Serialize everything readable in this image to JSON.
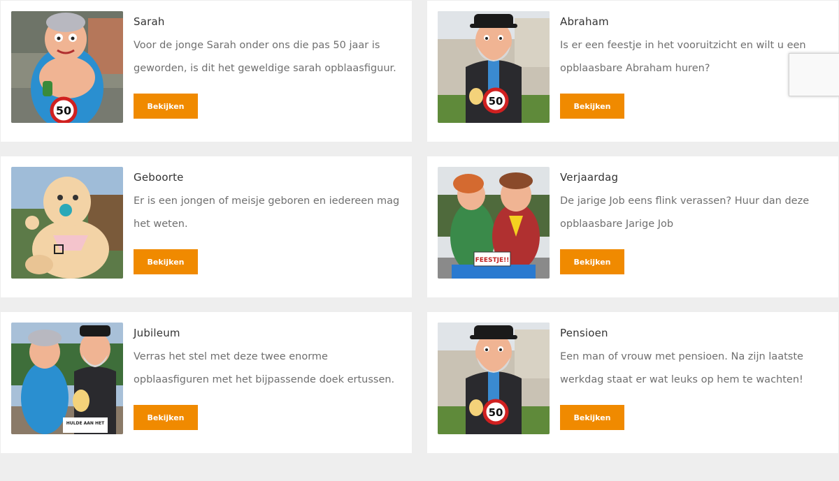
{
  "cards": [
    {
      "title": "Sarah",
      "description": "Voor de jonge Sarah onder ons die pas 50 jaar is geworden, is dit het geweldige sarah opblaasfiguur.",
      "button": "Bekijken",
      "image": "sarah-inflatable-photo"
    },
    {
      "title": "Abraham",
      "description": "Is er een feestje in het vooruitzicht en wilt u een opblaasbare Abraham huren?",
      "button": "Bekijken",
      "image": "abraham-inflatable-photo"
    },
    {
      "title": "Geboorte",
      "description": "Er is een jongen of meisje geboren en iedereen mag het weten.",
      "button": "Bekijken",
      "image": "baby-inflatable-photo"
    },
    {
      "title": "Verjaardag",
      "description": "De jarige Job eens flink verassen? Huur dan deze opblaasbare Jarige Job",
      "button": "Bekijken",
      "image": "birthday-couple-inflatable-photo",
      "sign_text": "FEESTJE!!"
    },
    {
      "title": "Jubileum",
      "description": "Verras het stel met deze twee enorme opblaasfiguren met het bijpassende doek ertussen.",
      "button": "Bekijken",
      "image": "jubilee-couple-inflatable-photo",
      "sign_text": "HULDE AAN HET"
    },
    {
      "title": "Pensioen",
      "description": "Een man of vrouw met pensioen. Na zijn laatste werkdag staat er wat leuks op hem te wachten!",
      "button": "Bekijken",
      "image": "retirement-inflatable-photo"
    }
  ],
  "colors": {
    "button": "#f08a00",
    "background": "#eeeeee",
    "card": "#ffffff"
  }
}
